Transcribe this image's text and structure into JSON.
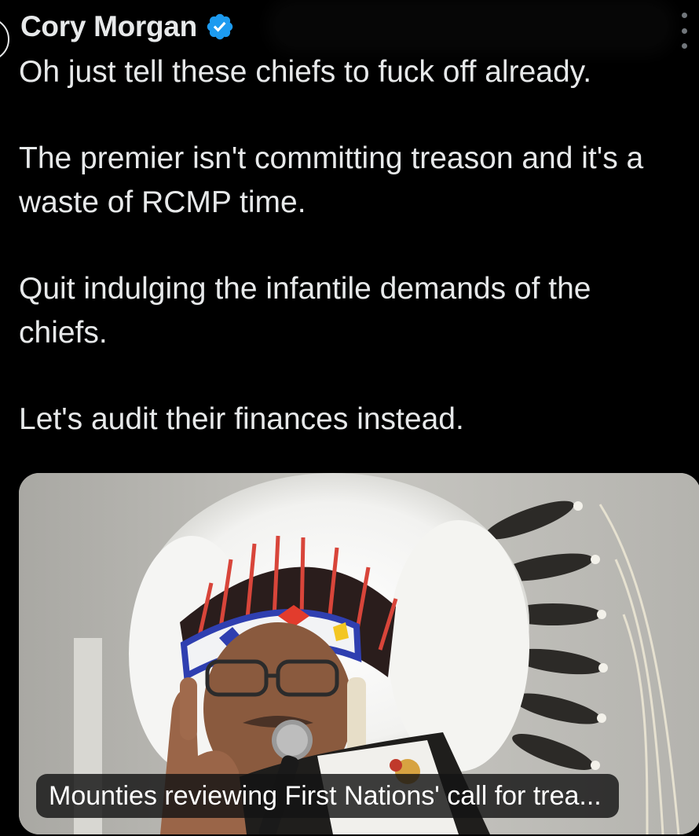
{
  "author": {
    "name": "Cory Morgan",
    "verified_icon": "verified-badge-icon",
    "verified_color": "#1d9bf0"
  },
  "tweet": {
    "paragraphs": [
      "Oh just tell these chiefs to fuck off already.",
      "The premier isn't committing treason and it's a waste of RCMP time.",
      "Quit indulging the infantile demands of the chiefs.",
      "Let's audit their finances instead."
    ]
  },
  "link_card": {
    "image": "photo of a First Nations chief in feathered headdress speaking into a microphone",
    "caption": "Mounties reviewing First Nations' call for trea..."
  },
  "icons": {
    "more": "more-options-icon"
  },
  "colors": {
    "background": "#000000",
    "text": "#e7e9ea",
    "muted": "#71767b"
  }
}
